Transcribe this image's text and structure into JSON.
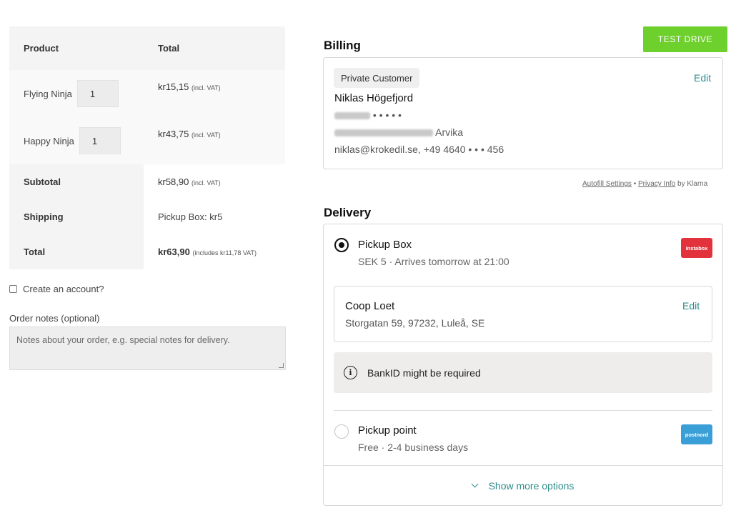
{
  "order": {
    "header": {
      "product": "Product",
      "total": "Total"
    },
    "items": [
      {
        "name": "Flying Ninja",
        "qty": "1",
        "amount": "kr15,15",
        "vat_note": "(incl. VAT)"
      },
      {
        "name": "Happy Ninja",
        "qty": "1",
        "amount": "kr43,75",
        "vat_note": "(incl. VAT)"
      }
    ],
    "subtotal": {
      "label": "Subtotal",
      "amount": "kr58,90",
      "note": "(incl. VAT)"
    },
    "shipping": {
      "label": "Shipping",
      "value": "Pickup Box: kr5"
    },
    "total": {
      "label": "Total",
      "amount": "kr63,90",
      "note": "(includes kr11,78 VAT)"
    }
  },
  "account": {
    "label": "Create an account?",
    "checked": false
  },
  "notes": {
    "label": "Order notes (optional)",
    "placeholder": "Notes about your order, e.g. special notes for delivery."
  },
  "test_drive": {
    "label": "TEST DRIVE",
    "color": "#6ed02c"
  },
  "billing": {
    "title": "Billing",
    "customer_type": "Private Customer",
    "edit": "Edit",
    "name": "Niklas Högefjord",
    "phone_masked": "• • • • •",
    "city": "Arvika",
    "contact": "niklas@krokedil.se, +49 4640  • • • 456"
  },
  "legal": {
    "autofill": "Autofill Settings",
    "sep": " • ",
    "privacy": "Privacy Info",
    "by": " by Klarna"
  },
  "delivery": {
    "title": "Delivery",
    "options": [
      {
        "title": "Pickup Box",
        "subtitle": "SEK 5 · Arrives tomorrow at 21:00",
        "logo": "instabox",
        "selected": true,
        "logo_color": "#e2323c"
      },
      {
        "title": "Pickup point",
        "subtitle": "Free · 2-4 business days",
        "logo": "postnord",
        "selected": false,
        "logo_color": "#3a9fd6"
      }
    ],
    "store": {
      "name": "Coop Loet",
      "address": "Storgatan 59, 97232, Luleå, SE",
      "edit": "Edit"
    },
    "notice": "BankID might be required",
    "show_more": "Show more options"
  },
  "colors": {
    "accent": "#2e8d8d"
  }
}
